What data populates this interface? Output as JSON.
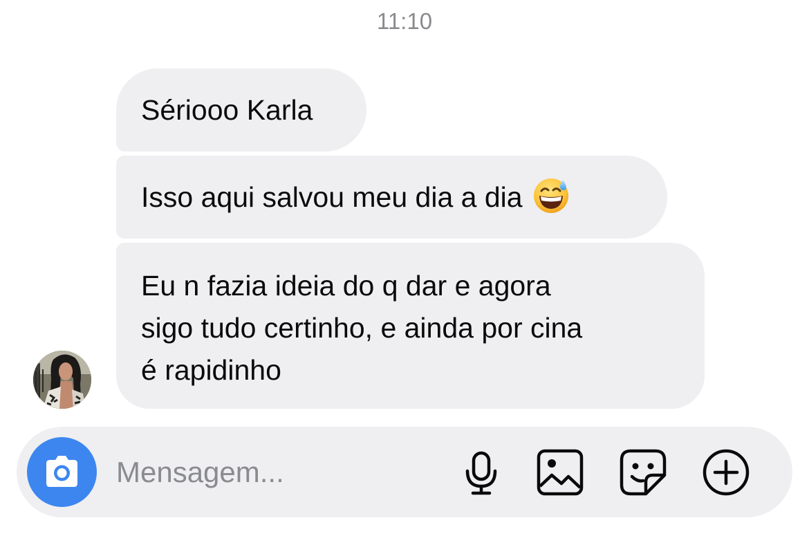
{
  "thread": {
    "timestamp": "11:10",
    "messages": [
      {
        "lines": [
          "Sériooo Karla"
        ]
      },
      {
        "lines": [
          "Isso aqui salvou meu dia a dia"
        ],
        "emoji": "grinning-face-with-sweat-icon"
      },
      {
        "lines": [
          "Eu n fazia ideia do q dar e agora",
          "sigo tudo certinho, e ainda por cina",
          "é rapidinho"
        ]
      }
    ],
    "sender_avatar": "contact-avatar-photo"
  },
  "composer": {
    "placeholder": "Mensagem...",
    "value": "",
    "icons": [
      "camera-icon",
      "microphone-icon",
      "gallery-icon",
      "sticker-icon",
      "plus-circle-icon"
    ],
    "camera_color": "#3d86f0"
  },
  "colors": {
    "bubble": "#efeff1",
    "text": "#0a0a0a",
    "timestamp": "#8a8a8e",
    "placeholder": "#8a8b8e"
  }
}
